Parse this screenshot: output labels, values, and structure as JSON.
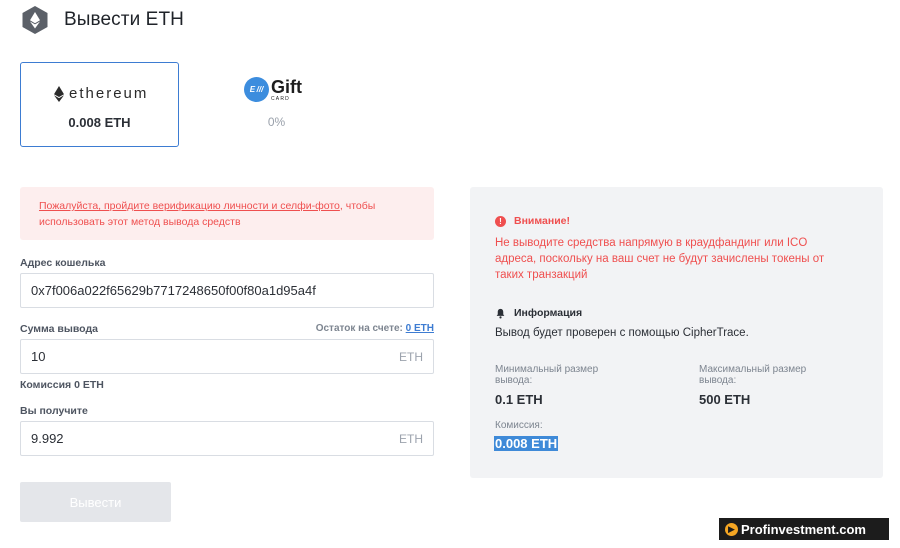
{
  "header": {
    "title": "Вывести ETH",
    "icon": "ethereum-hex-icon"
  },
  "methods": [
    {
      "name": "ethereum",
      "value": "0.008 ETH",
      "selected": true
    },
    {
      "name": "Gift",
      "sub": "CARD",
      "badge": "E ///",
      "value": "0%",
      "selected": false
    }
  ],
  "alert": {
    "link_text": "Пожалуйста, пройдите верификацию личности и селфи-фото",
    "rest_text": ", чтобы использовать этот метод вывода средств"
  },
  "form": {
    "wallet_label": "Адрес кошелька",
    "wallet_value": "0x7f006a022f65629b7717248650f00f80a1d95a4f",
    "amount_label": "Сумма вывода",
    "balance_label": "Остаток на счете:",
    "balance_value": "0 ETH",
    "amount_value": "10",
    "amount_unit": "ETH",
    "commission": "Комиссия 0 ETH",
    "receive_label": "Вы получите",
    "receive_value": "9.992",
    "receive_unit": "ETH",
    "submit_label": "Вывести"
  },
  "info": {
    "warning_title": "Внимание!",
    "warning_text": "Не выводите средства напрямую в краудфандинг или ICO адреса, поскольку на ваш счет не будут зачислены токены от таких транзакций",
    "info_title": "Информация",
    "info_text": "Вывод будет проверен с помощью CipherTrace.",
    "min_label_1": "Минимальный размер",
    "min_label_2": "вывода:",
    "min_value": "0.1 ETH",
    "max_label_1": "Максимальный размер",
    "max_label_2": "вывода:",
    "max_value": "500 ETH",
    "fee_label": "Комиссия:",
    "fee_value": "0.008 ETH"
  },
  "watermark": {
    "text": "Profinvestment.com"
  },
  "colors": {
    "accent": "#3d7cd2",
    "error": "#ef4f4f",
    "panel": "#f2f3f5"
  }
}
